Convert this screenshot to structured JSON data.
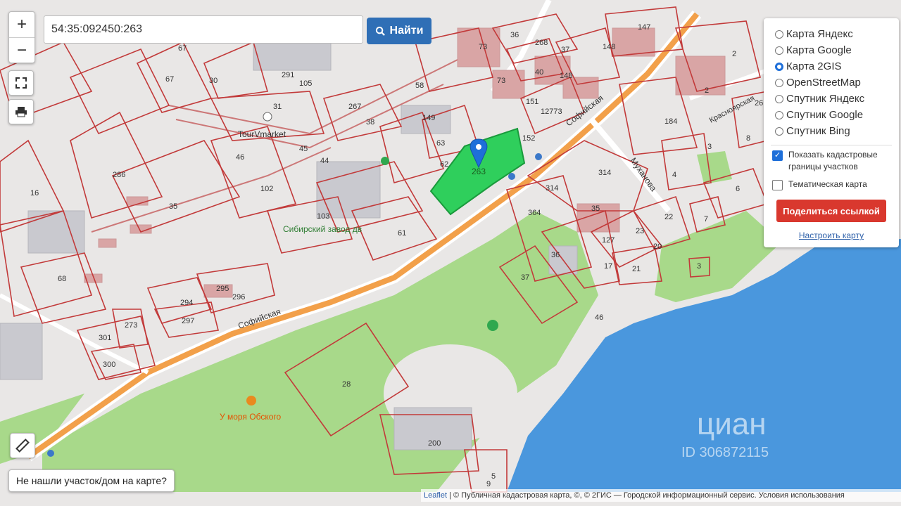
{
  "colors": {
    "map_bg": "#e9e7e6",
    "park": "#a8d98a",
    "water": "#4a97dd",
    "road": "#f2a04a",
    "parcel_line": "#c23a3a",
    "building": "#d9a5a5",
    "highlight_parcel": "#2fcf5c",
    "marker": "#1e6fd9",
    "find_button": "#2f6fb6",
    "share_button": "#d9382e"
  },
  "controls": {
    "zoom_in": "+",
    "zoom_out": "−",
    "fullscreen_icon": "expand-icon",
    "print_icon": "printer-icon",
    "ruler_icon": "ruler-icon"
  },
  "search": {
    "value": "54:35:092450:263",
    "button_label": "Найти"
  },
  "layer_panel": {
    "base_layers": [
      {
        "label": "Карта Яндекс",
        "selected": false
      },
      {
        "label": "Карта Google",
        "selected": false
      },
      {
        "label": "Карта 2GIS",
        "selected": true
      },
      {
        "label": "OpenStreetMap",
        "selected": false
      },
      {
        "label": "Спутник Яндекс",
        "selected": false
      },
      {
        "label": "Спутник Google",
        "selected": false
      },
      {
        "label": "Спутник Bing",
        "selected": false
      }
    ],
    "show_cadastral": {
      "label": "Показать кадастровые границы участков",
      "checked": true
    },
    "thematic_map": {
      "label": "Тематическая карта",
      "checked": false
    },
    "share_button": "Поделиться ссылкой",
    "configure_link": "Настроить карту"
  },
  "not_found_button": "Не нашли участок/дом на карте?",
  "attribution": {
    "leaflet": "Leaflet",
    "text": " | © Публичная кадастровая карта, ©, © 2ГИС — Городской информационный сервис. Условия использования"
  },
  "map_labels": {
    "selected_parcel": "263",
    "street_sofiyskaya": "Софийская",
    "street_sofiyskaya_2": "Софийская",
    "street_mukhanova": "Муханова",
    "street_krasnoyarskaya": "Красноярская",
    "poi_tourvmarket": "TourVmarket",
    "poi_siberian_plant": "Сибирский завод дв",
    "poi_u_morya": "У моря Обского",
    "parcels": [
      "67",
      "67",
      "30",
      "291",
      "31",
      "105",
      "73",
      "73",
      "36",
      "37",
      "268",
      "40",
      "148",
      "147",
      "152",
      "148",
      "151",
      "12773",
      "38",
      "149",
      "267",
      "58",
      "45",
      "44",
      "46",
      "286",
      "35",
      "102",
      "103",
      "16",
      "63",
      "62",
      "61",
      "314",
      "314",
      "35",
      "364",
      "127",
      "23",
      "22",
      "20",
      "21",
      "17",
      "36",
      "37",
      "3",
      "46",
      "4",
      "6",
      "7",
      "184",
      "2",
      "2",
      "26",
      "3",
      "8",
      "68",
      "294",
      "295",
      "296",
      "297",
      "301",
      "273",
      "300",
      "28",
      "200",
      "9",
      "5"
    ]
  },
  "watermarks": {
    "cian": "циан",
    "cian_id": "ID 30687211​5"
  }
}
